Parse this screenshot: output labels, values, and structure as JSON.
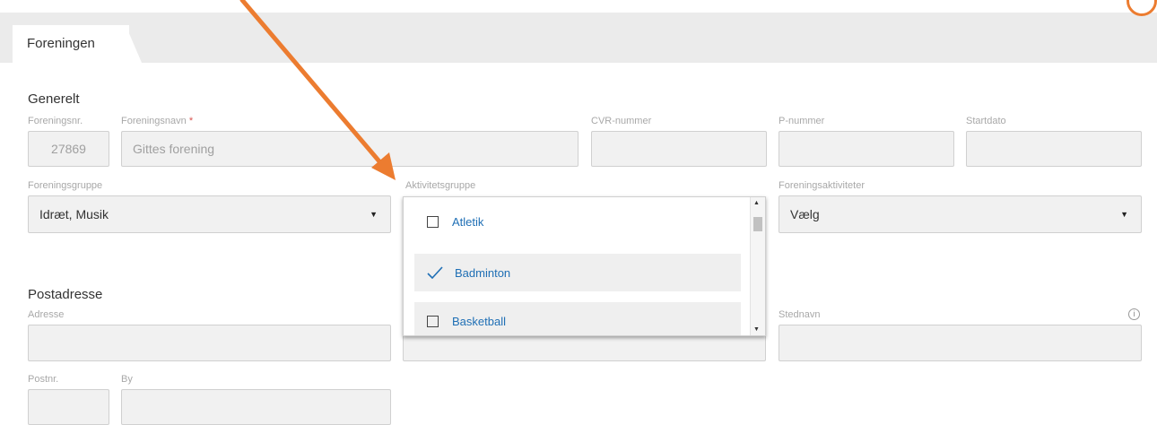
{
  "tabs": {
    "active": "Foreningen"
  },
  "sections": {
    "general": "Generelt",
    "postal": "Postadresse"
  },
  "labels": {
    "forening_nr": "Foreningsnr.",
    "foreningsnavn": "Foreningsnavn",
    "required_mark": "*",
    "cvr": "CVR-nummer",
    "p_nummer": "P-nummer",
    "startdato": "Startdato",
    "foreningsgruppe": "Foreningsgruppe",
    "aktivitetsgruppe": "Aktivitetsgruppe",
    "foreningsaktiviteter": "Foreningsaktiviteter",
    "adresse": "Adresse",
    "stednavn": "Stednavn",
    "postnr": "Postnr.",
    "by": "By"
  },
  "values": {
    "forening_nr": "27869",
    "foreningsnavn": "Gittes forening",
    "foreningsgruppe": "Idræt, Musik",
    "foreningsaktiviteter": "Vælg"
  },
  "dropdown": {
    "items": [
      {
        "label": "Atletik",
        "checked": false
      },
      {
        "label": "Badminton",
        "checked": true
      },
      {
        "label": "Basketball",
        "checked": false
      }
    ]
  },
  "colors": {
    "annotation_arrow": "#ec7c30",
    "link_text": "#1f6fb5",
    "required": "#d9534f"
  },
  "icons": {
    "caret": "caret-down-icon",
    "info": "info-icon",
    "check": "check-icon",
    "checkbox": "checkbox-icon"
  }
}
